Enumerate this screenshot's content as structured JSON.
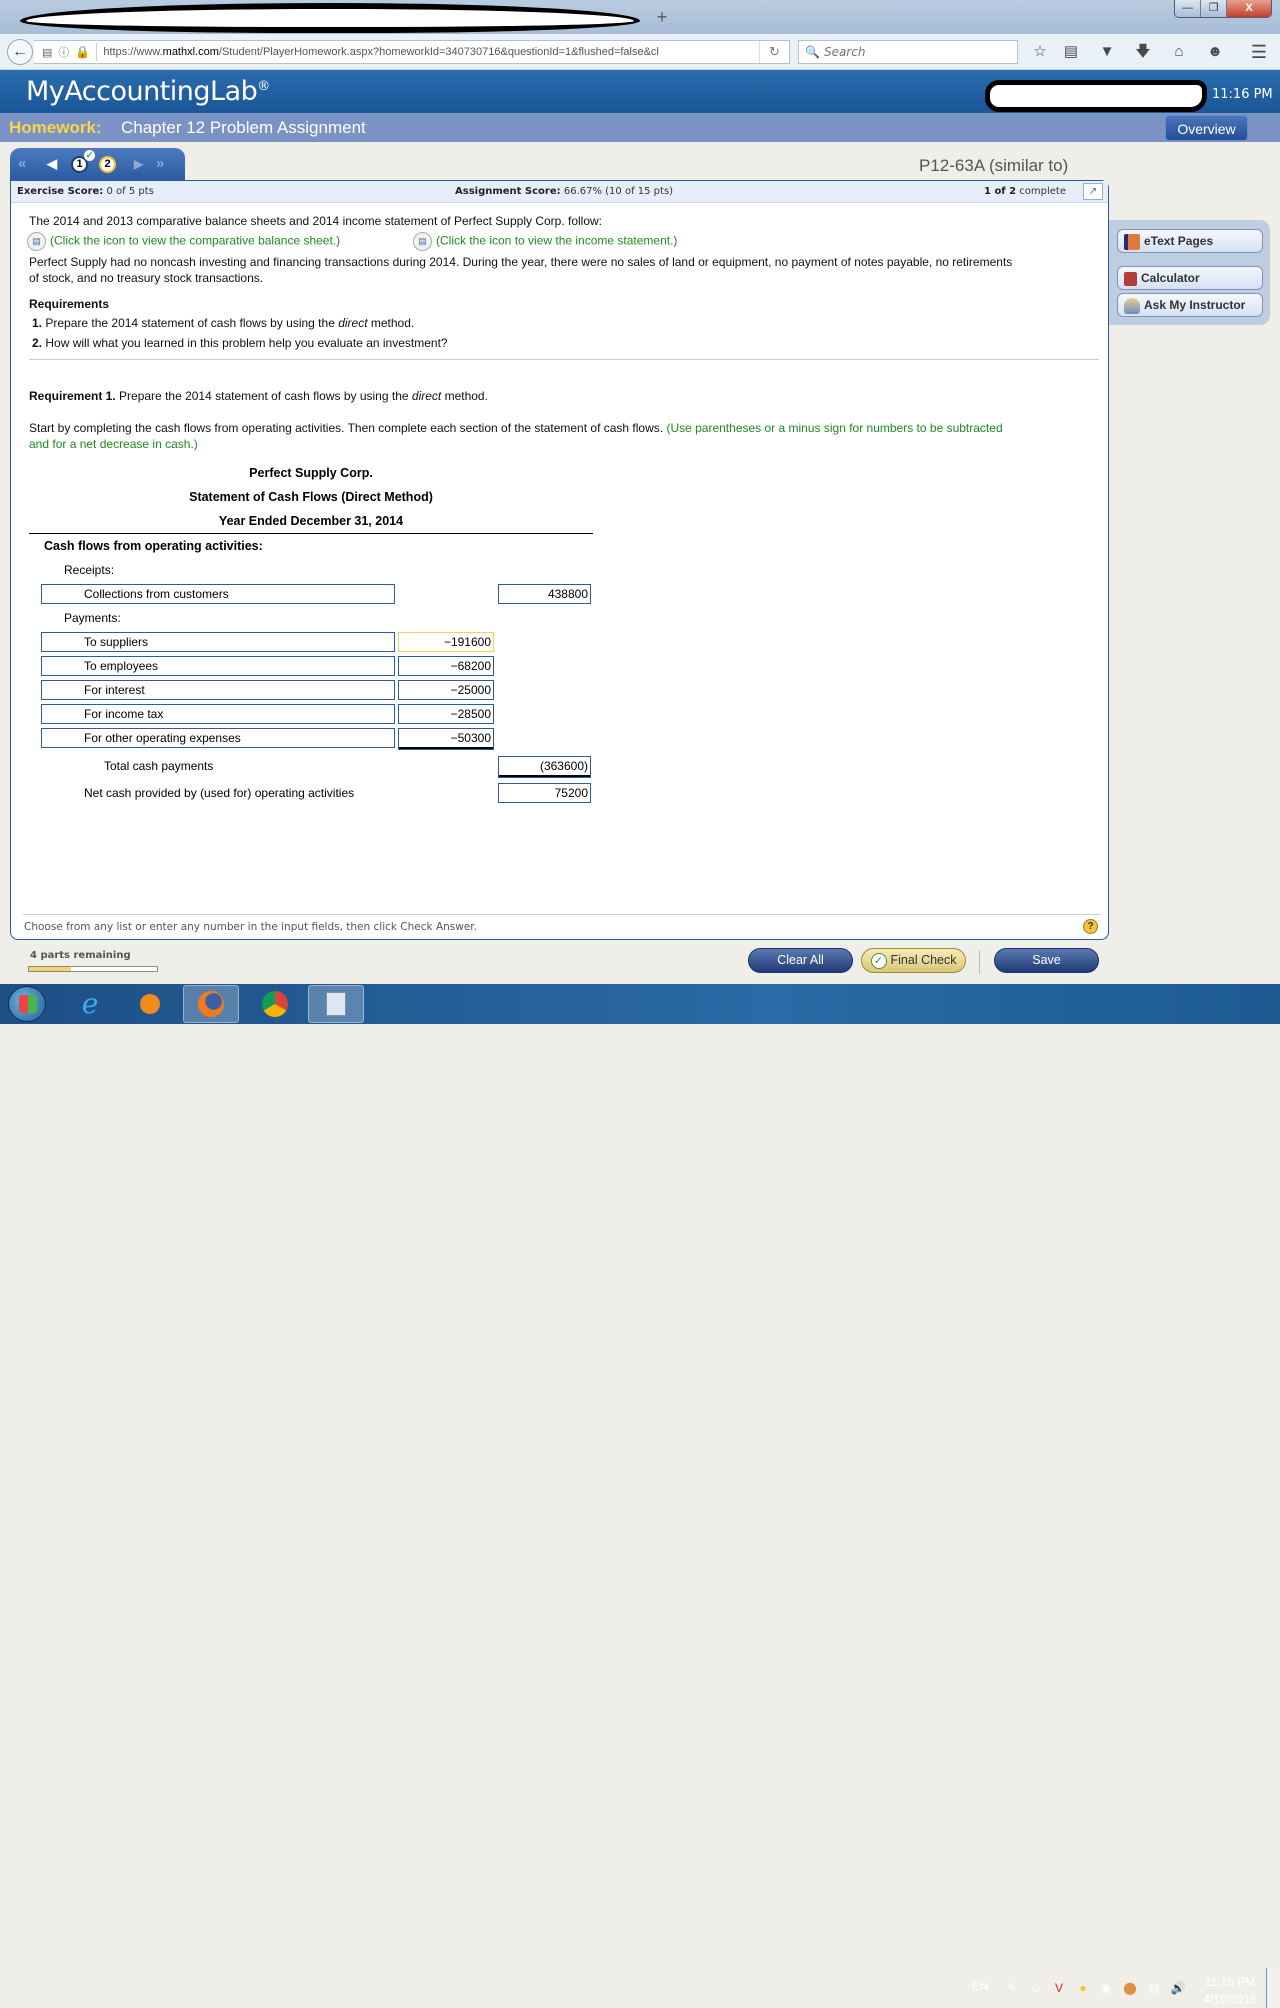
{
  "browser": {
    "new_tab_label": "+",
    "url_prefix": "https://www.",
    "url_domain": "mathxl.com",
    "url_path": "/Student/PlayerHomework.aspx?homeworkId=340730716&questionId=1&flushed=false&cl",
    "search_placeholder": "Search",
    "window_controls": {
      "minimize": "—",
      "restore": "❐",
      "close": "X"
    }
  },
  "app": {
    "logo": "MyAccountingLab",
    "logo_mark": "®",
    "header_time": "11:16 PM",
    "homework_label": "Homework:",
    "homework_title": "Chapter 12 Problem Assignment",
    "overview_label": "Overview"
  },
  "question_nav": {
    "first": "«",
    "prev": "◀",
    "next": "▶",
    "last": "»",
    "items": [
      {
        "number": "1",
        "status": "correct"
      },
      {
        "number": "2",
        "status": "current"
      }
    ],
    "problem_id": "P12-63A (similar to)"
  },
  "scores": {
    "exercise_label": "Exercise Score:",
    "exercise_value": "0 of 5 pts",
    "assignment_label": "Assignment Score:",
    "assignment_value": "66.67% (10 of 15 pts)",
    "complete_bold": "1 of 2",
    "complete_text": "complete"
  },
  "problem": {
    "intro": "The 2014 and 2013 comparative balance sheets and 2014 income statement of Perfect Supply Corp. follow:",
    "link_balance": "(Click the icon to view the comparative balance sheet.)",
    "link_income": "(Click the icon to view the income statement.)",
    "note_line1": "Perfect Supply had no noncash investing and financing transactions during 2014. During the year, there were no sales of land or equipment, no payment of notes payable, no retirements",
    "note_line2": "of stock, and no treasury stock transactions.",
    "requirements_heading": "Requirements",
    "requirements": [
      {
        "num": "1.",
        "pre": "Prepare the 2014 statement of cash flows by using the ",
        "em": "direct",
        "post": " method."
      },
      {
        "num": "2.",
        "pre": "How will what you learned in this problem help you evaluate an investment?",
        "em": "",
        "post": ""
      }
    ],
    "req1_bold": "Requirement 1.",
    "req1_pre": " Prepare the 2014 statement of cash flows by using the ",
    "req1_em": "direct",
    "req1_post": " method.",
    "instruction_line1": "Start by completing the cash flows from operating activities. Then complete each section of the statement of cash flows.",
    "instruction_green1": " (Use parentheses or a minus sign for numbers to be subtracted",
    "instruction_green2": "and for a net decrease in cash.)"
  },
  "statement": {
    "company": "Perfect Supply Corp.",
    "title": "Statement of Cash Flows (Direct Method)",
    "period": "Year Ended December 31, 2014",
    "section_heading": "Cash flows from operating activities:",
    "receipts_label": "Receipts:",
    "receipts": [
      {
        "label": "Collections from customers",
        "amount": "438800"
      }
    ],
    "payments_label": "Payments:",
    "payments": [
      {
        "label": "To suppliers",
        "amount": "−191600"
      },
      {
        "label": "To employees",
        "amount": "−68200"
      },
      {
        "label": "For interest",
        "amount": "−25000"
      },
      {
        "label": "For income tax",
        "amount": "−28500"
      },
      {
        "label": "For other operating expenses",
        "amount": "−50300"
      }
    ],
    "total_payments_label": "Total cash payments",
    "total_payments_value": "(363600)",
    "net_label": "Net cash provided by (used for) operating activities",
    "net_value": "75200"
  },
  "footer": {
    "instruction": "Choose from any list or enter any number in the input fields, then click Check Answer.",
    "help": "?",
    "parts_remaining": "4 parts remaining",
    "progress_fraction": 0.33,
    "clear_all": "Clear All",
    "final_check": "Final Check",
    "save": "Save"
  },
  "tools": {
    "etext": "eText Pages",
    "calculator": "Calculator",
    "ask": "Ask My Instructor"
  },
  "taskbar": {
    "apps": [
      "internet-explorer",
      "media-player",
      "firefox",
      "chrome",
      "calculator"
    ],
    "language": "EN",
    "time": "11:16 PM",
    "date": "4/10/2016"
  }
}
